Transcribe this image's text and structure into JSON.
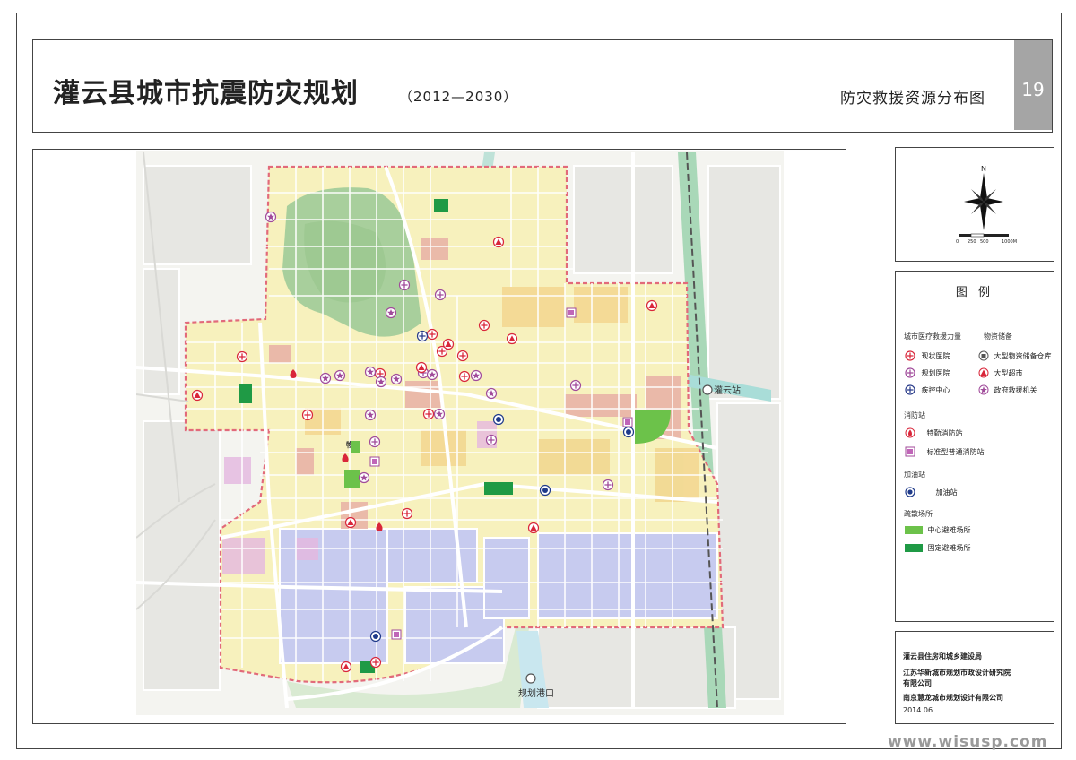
{
  "header": {
    "title": "灌云县城市抗震防灾规划",
    "years": "（2012—2030）",
    "subtitle": "防灾救援资源分布图",
    "page_number": "19"
  },
  "compass": {
    "north": "N",
    "scale": [
      "0",
      "250",
      "500",
      "1000M"
    ]
  },
  "legend": {
    "title": "图 例",
    "groups": {
      "medical": "城市医疗救援力量",
      "supplies": "物资储备",
      "fire": "消防站",
      "fuel": "加油站",
      "shelter": "疏散场所"
    },
    "items": {
      "existing_hospital": "现状医院",
      "planned_hospital": "规划医院",
      "disease_center": "疾控中心",
      "warehouse": "大型物资储备仓库",
      "supermarket": "大型超市",
      "gov_agency": "政府救援机关",
      "special_fire": "特勤消防站",
      "standard_fire": "标准型普通消防站",
      "gas_station": "加油站",
      "central_shelter": "中心避难场所",
      "fixed_shelter": "固定避难场所"
    }
  },
  "map": {
    "labels": {
      "station": "灌云站",
      "port": "规划港口",
      "warehouse_mark": "物"
    }
  },
  "credits": {
    "line1": "灌云县住房和城乡建设局",
    "line2": "江苏华新城市规划市政设计研究院",
    "line3": "有限公司",
    "line4": "南京慧龙城市规划设计有限公司",
    "date": "2014.06"
  },
  "watermark": "www.wisusp.com",
  "colors": {
    "residential": "#f6efb4",
    "residential_dark": "#f2d58c",
    "industrial": "#c6cbee",
    "commercial": "#e8b0a6",
    "park": "#b9dda9",
    "hill": "#a8cf9c",
    "water": "#a9ddd8",
    "boundary": "#e26a7a",
    "central_shelter": "#6cc24a",
    "fixed_shelter": "#1f9a45",
    "hospital_red": "#d9263a",
    "planned_purple": "#a04a9a",
    "disease_blue": "#2a3c8a",
    "gas_blue": "#1f3a8a"
  },
  "markers": {
    "existing_hospital": [
      [
        270,
        398
      ],
      [
        343,
        463
      ],
      [
        478,
        462
      ],
      [
        482,
        373
      ],
      [
        493,
        392
      ],
      [
        516,
        397
      ],
      [
        540,
        363
      ],
      [
        454,
        573
      ],
      [
        419,
        739
      ],
      [
        424,
        417
      ],
      [
        518,
        420
      ]
    ],
    "planned_hospital": [
      [
        451,
        318
      ],
      [
        418,
        493
      ],
      [
        642,
        430
      ],
      [
        678,
        541
      ],
      [
        491,
        329
      ],
      [
        548,
        491
      ],
      [
        472,
        416
      ]
    ],
    "disease_center": [
      [
        471,
        375
      ]
    ],
    "supermarket": [
      [
        220,
        441
      ],
      [
        556,
        270
      ],
      [
        727,
        341
      ],
      [
        571,
        378
      ],
      [
        500,
        384
      ],
      [
        470,
        410
      ],
      [
        391,
        583
      ],
      [
        595,
        589
      ],
      [
        386,
        744
      ]
    ],
    "gov_agency": [
      [
        302,
        242
      ],
      [
        436,
        349
      ],
      [
        379,
        419
      ],
      [
        413,
        415
      ],
      [
        442,
        423
      ],
      [
        531,
        419
      ],
      [
        548,
        439
      ],
      [
        490,
        462
      ],
      [
        413,
        463
      ],
      [
        425,
        426
      ],
      [
        482,
        418
      ],
      [
        363,
        422
      ],
      [
        406,
        533
      ]
    ],
    "special_fire": [
      [
        327,
        417
      ],
      [
        423,
        588
      ],
      [
        385,
        511
      ]
    ],
    "standard_fire": [
      [
        637,
        349
      ],
      [
        700,
        471
      ],
      [
        442,
        708
      ],
      [
        418,
        515
      ]
    ],
    "gas_station": [
      [
        556,
        468
      ],
      [
        608,
        547
      ],
      [
        701,
        482
      ],
      [
        419,
        710
      ]
    ],
    "central_shelter": [
      [
        391,
        492,
        11,
        14
      ],
      [
        384,
        524,
        18,
        20
      ],
      [
        708,
        457,
        40,
        38
      ]
    ],
    "fixed_shelter": [
      [
        484,
        222,
        16,
        14
      ],
      [
        267,
        428,
        14,
        22
      ],
      [
        540,
        538,
        32,
        14
      ],
      [
        402,
        737,
        16,
        14
      ]
    ]
  }
}
